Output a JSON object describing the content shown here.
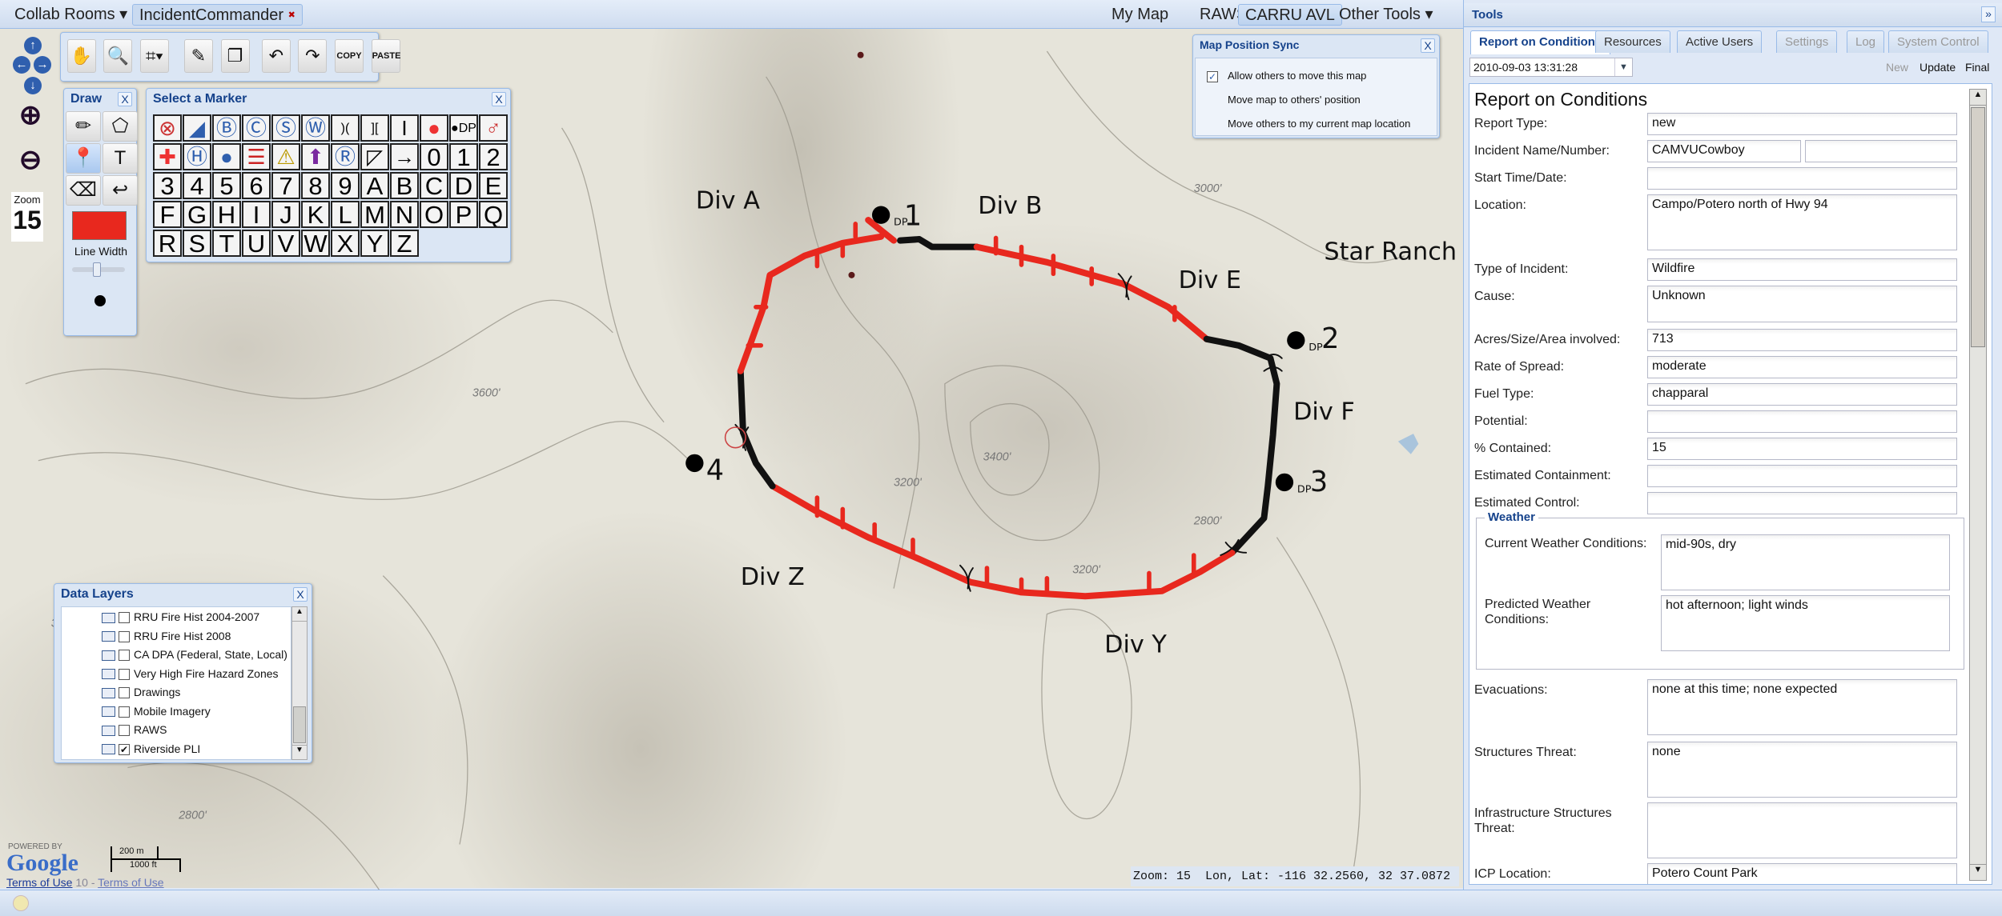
{
  "topbar": {
    "collab_rooms": "Collab Rooms ▾",
    "room_tab": "IncidentCommander",
    "room_tab_close": "✖",
    "right_items": [
      "My Map",
      "RAWS",
      "CARRU AVL",
      "Other Tools ▾"
    ],
    "active_item": "CARRU AVL"
  },
  "map_controls": {
    "zoom_label": "Zoom",
    "zoom_value": "15",
    "toolbar": [
      {
        "icon": "hand-icon",
        "glyph": "✋"
      },
      {
        "icon": "magnifier-icon",
        "glyph": "🔍"
      },
      {
        "icon": "crop-icon",
        "glyph": "⌗▾"
      },
      {
        "icon": "pencil-icon",
        "glyph": "✎"
      },
      {
        "icon": "layers-icon",
        "glyph": "❐"
      },
      {
        "icon": "undo-icon",
        "glyph": "↶"
      },
      {
        "icon": "redo-icon",
        "glyph": "↷"
      },
      {
        "icon": "copy-icon",
        "glyph": "COPY"
      },
      {
        "icon": "paste-icon",
        "glyph": "PASTE"
      }
    ]
  },
  "draw_panel": {
    "title": "Draw",
    "close": "X",
    "tools": [
      {
        "icon": "pencil-icon",
        "glyph": "✏"
      },
      {
        "icon": "polygon-icon",
        "glyph": "⬠"
      },
      {
        "icon": "marker-pin-icon",
        "glyph": "📍"
      },
      {
        "icon": "text-icon",
        "glyph": "T"
      },
      {
        "icon": "eraser-icon",
        "glyph": "⌫"
      },
      {
        "icon": "redo-arrow-icon",
        "glyph": "↩"
      }
    ],
    "color": "#e8281e",
    "line_width_label": "Line Width"
  },
  "marker_panel": {
    "title": "Select a Marker",
    "close": "X",
    "markers": [
      "⊗",
      "◢",
      "Ⓑ",
      "Ⓒ",
      "Ⓢ",
      "Ⓦ",
      ")(",
      "][",
      "I",
      "●",
      "●DP",
      "♂",
      "✚",
      "Ⓗ",
      "●",
      "☰",
      "⚠",
      "⬆",
      "Ⓡ",
      "◸",
      "→",
      "0",
      "1",
      "2",
      "3",
      "4",
      "5",
      "6",
      "7",
      "8",
      "9",
      "A",
      "B",
      "C",
      "D",
      "E",
      "F",
      "G",
      "H",
      "I",
      "J",
      "K",
      "L",
      "M",
      "N",
      "O",
      "P",
      "Q",
      "R",
      "S",
      "T",
      "U",
      "V",
      "W",
      "X",
      "Y",
      "Z"
    ]
  },
  "sync_panel": {
    "title": "Map Position Sync",
    "close": "X",
    "allow_label": "Allow others to move this map",
    "allow_checked": true,
    "move_to_others": "Move map to others' position",
    "move_others": "Move others to my current map location"
  },
  "data_layers": {
    "title": "Data Layers",
    "close": "X",
    "items": [
      {
        "label": "RRU Fire Hist 2004-2007",
        "checked": false
      },
      {
        "label": "RRU Fire Hist 2008",
        "checked": false
      },
      {
        "label": "CA DPA (Federal, State, Local)",
        "checked": false
      },
      {
        "label": "Very High Fire Hazard Zones",
        "checked": false
      },
      {
        "label": "Drawings",
        "checked": false
      },
      {
        "label": "Mobile Imagery",
        "checked": false
      },
      {
        "label": "RAWS",
        "checked": false
      },
      {
        "label": "Riverside PLI",
        "checked": true
      }
    ]
  },
  "map": {
    "labels": {
      "div_a": "Div A",
      "div_b": "Div B",
      "div_e": "Div E",
      "div_f": "Div F",
      "div_z": "Div Z",
      "div_y": "Div Y",
      "star_ranch": "Star Ranch",
      "dp1": "1",
      "dp2": "2",
      "dp3": "3",
      "dp4": "4",
      "dp": "DP"
    },
    "contour_labels": [
      "3400'",
      "3200'",
      "3000'",
      "2800'",
      "3600'",
      "3000'",
      "2800'",
      "3200'"
    ],
    "perimeter_colors": {
      "uncontained": "#e8281e",
      "contained": "#111111"
    },
    "google_powered": "POWERED BY",
    "google_logo": "Google",
    "scale_m": "200 m",
    "scale_ft": "1000 ft",
    "terms1": "Terms of Use",
    "terms_mid": "10 -",
    "terms2": "Terms of Use",
    "coords": "Zoom: 15  Lon, Lat: -116 32.2560, 32 37.0872"
  },
  "tools": {
    "title": "Tools",
    "collapse": "»",
    "tabs": [
      {
        "label": "Report on Conditions",
        "state": "active"
      },
      {
        "label": "Resources",
        "state": "normal"
      },
      {
        "label": "Active Users",
        "state": "normal"
      },
      {
        "label": "Settings",
        "state": "disabled"
      },
      {
        "label": "Log",
        "state": "disabled"
      },
      {
        "label": "System Control",
        "state": "disabled"
      }
    ],
    "report_date": "2010-09-03 13:31:28",
    "actions": {
      "new": "New",
      "update": "Update",
      "final": "Final"
    },
    "form": {
      "heading": "Report on Conditions",
      "fields": [
        {
          "label": "Report Type:",
          "value": "new"
        },
        {
          "label": "Incident Name/Number:",
          "value": "CAMVUCowboy",
          "value2": ""
        },
        {
          "label": "Start Time/Date:",
          "value": ""
        },
        {
          "label": "Location:",
          "value": "Campo/Potero north of Hwy 94"
        },
        {
          "label": "Type of Incident:",
          "value": "Wildfire"
        },
        {
          "label": "Cause:",
          "value": "Unknown"
        },
        {
          "label": "Acres/Size/Area involved:",
          "value": "713"
        },
        {
          "label": "Rate of Spread:",
          "value": "moderate"
        },
        {
          "label": "Fuel Type:",
          "value": "chapparal"
        },
        {
          "label": "Potential:",
          "value": ""
        },
        {
          "label": "% Contained:",
          "value": "15"
        },
        {
          "label": "Estimated Containment:",
          "value": ""
        },
        {
          "label": "Estimated Control:",
          "value": ""
        }
      ],
      "weather": {
        "legend": "Weather",
        "current_label": "Current Weather Conditions:",
        "current_value": "mid-90s, dry",
        "predicted_label": "Predicted Weather Conditions:",
        "predicted_value": "hot afternoon; light winds"
      },
      "fields2": [
        {
          "label": "Evacuations:",
          "value": "none at this time;  none expected"
        },
        {
          "label": "Structures Threat:",
          "value": "none"
        },
        {
          "label": "Infrastructure Structures Threat:",
          "value": ""
        },
        {
          "label": "ICP Location:",
          "value": "Potero Count Park"
        }
      ]
    }
  }
}
